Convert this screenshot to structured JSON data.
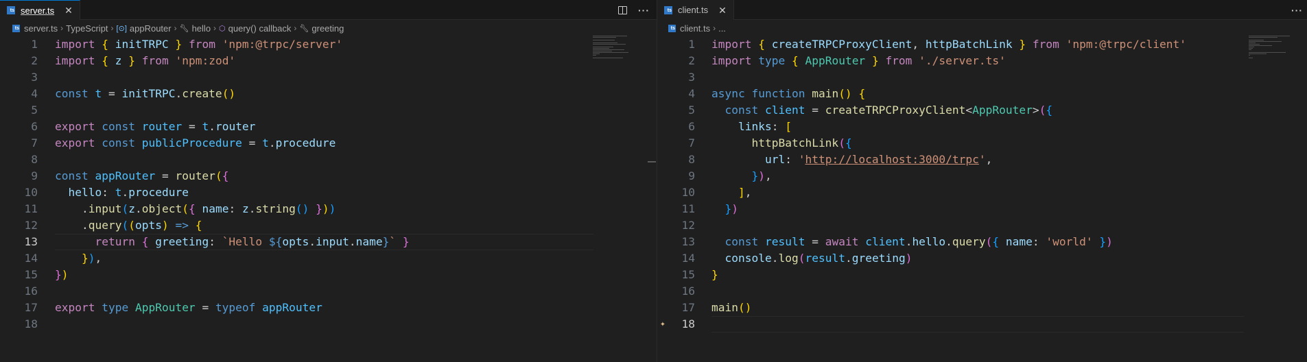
{
  "left": {
    "tab": {
      "label": "server.ts",
      "close": "✕"
    },
    "actions": {
      "more": "···"
    },
    "breadcrumb": {
      "file": "server.ts",
      "s1": "TypeScript",
      "s2": "appRouter",
      "s3": "hello",
      "s4": "query() callback",
      "s5": "greeting"
    },
    "line_numbers": [
      "1",
      "2",
      "3",
      "4",
      "5",
      "6",
      "7",
      "8",
      "9",
      "10",
      "11",
      "12",
      "13",
      "14",
      "15",
      "16",
      "17",
      "18"
    ],
    "code": [
      "import { initTRPC } from 'npm:@trpc/server'",
      "import { z } from 'npm:zod'",
      "",
      "const t = initTRPC.create()",
      "",
      "export const router = t.router",
      "export const publicProcedure = t.procedure",
      "",
      "const appRouter = router({",
      "  hello: t.procedure",
      "    .input(z.object({ name: z.string() }))",
      "    .query((opts) => {",
      "      return { greeting: `Hello ${opts.input.name}` }",
      "    }),",
      "})",
      "",
      "export type AppRouter = typeof appRouter",
      ""
    ]
  },
  "right": {
    "tab": {
      "label": "client.ts",
      "close": "✕"
    },
    "actions": {
      "more": "···"
    },
    "breadcrumb": {
      "file": "client.ts",
      "s1": "..."
    },
    "line_numbers": [
      "1",
      "2",
      "3",
      "4",
      "5",
      "6",
      "7",
      "8",
      "9",
      "10",
      "11",
      "12",
      "13",
      "14",
      "15",
      "16",
      "17",
      "18"
    ],
    "code": [
      "import { createTRPCProxyClient, httpBatchLink } from 'npm:@trpc/client'",
      "import type { AppRouter } from './server.ts'",
      "",
      "async function main() {",
      "  const client = createTRPCProxyClient<AppRouter>({",
      "    links: [",
      "      httpBatchLink({",
      "        url: 'http://localhost:3000/trpc',",
      "      }),",
      "    ],",
      "  })",
      "",
      "  const result = await client.hello.query({ name: 'world' })",
      "  console.log(result.greeting)",
      "}",
      "",
      "main()",
      ""
    ]
  },
  "colors": {
    "keyword": "#569cd6",
    "control": "#c586c0",
    "variable": "#9cdcfe",
    "function": "#dcdcaa",
    "string": "#ce9178",
    "type": "#4ec9b0",
    "accent": "#0078d4",
    "editor_bg": "#1f1f1f"
  }
}
